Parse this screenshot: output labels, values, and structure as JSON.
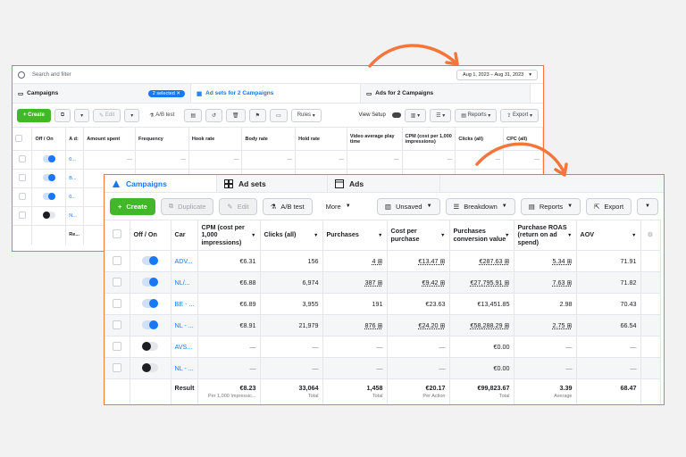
{
  "back": {
    "search_placeholder": "Search and filter",
    "date_range": "Aug 1, 2023 – Aug 31, 2023",
    "tabs": {
      "campaigns": "Campaigns",
      "selected": "2 selected",
      "adsets": "Ad sets for 2 Campaigns",
      "ads": "Ads for 2 Campaigns"
    },
    "toolbar": {
      "create": "Create",
      "edit": "Edit",
      "ab_test": "A/B test",
      "rules": "Rules",
      "view_setup": "View Setup",
      "reports": "Reports",
      "export": "Export"
    },
    "columns": [
      "Off / On",
      "A d:",
      "Amount spent",
      "Frequency",
      "Hook rate",
      "Body rate",
      "Hold rate",
      "Video average play time",
      "CPM (cost per 1,000 impressions)",
      "Clicks (all)",
      "CPC (all)"
    ],
    "rows": [
      {
        "name": "0...",
        "on": true
      },
      {
        "name": "B...",
        "on": true
      },
      {
        "name": "0...",
        "on": true
      },
      {
        "name": "N...",
        "on": false
      }
    ],
    "summary_label": "Re..."
  },
  "front": {
    "tabs": {
      "campaigns": "Campaigns",
      "adsets": "Ad sets",
      "ads": "Ads"
    },
    "toolbar": {
      "create": "Create",
      "duplicate": "Duplicate",
      "edit": "Edit",
      "ab_test": "A/B test",
      "more": "More",
      "unsaved": "Unsaved",
      "breakdown": "Breakdown",
      "reports": "Reports",
      "export": "Export"
    },
    "columns": {
      "offon": "Off / On",
      "campaign": "Car",
      "cpm": "CPM (cost per 1,000 impressions)",
      "clicks": "Clicks (all)",
      "purchases": "Purchases",
      "cpp": "Cost per purchase",
      "conv_value": "Purchases conversion value",
      "roas": "Purchase ROAS (return on ad spend)",
      "aov": "AOV"
    },
    "rows": [
      {
        "name": "ADV...",
        "on": true,
        "cpm": "€6.31",
        "clicks": "156",
        "purchases": "4 ⊞",
        "cpp": "€13.47 ⊞",
        "value": "€287.63 ⊞",
        "roas": "5.34 ⊞",
        "aov": "71.91"
      },
      {
        "name": "NL/...",
        "on": true,
        "cpm": "€6.88",
        "clicks": "6,974",
        "purchases": "387 ⊞",
        "cpp": "€9.42 ⊞",
        "value": "€27,795.91 ⊞",
        "roas": "7.63 ⊞",
        "aov": "71.82"
      },
      {
        "name": "BE - ...",
        "on": true,
        "cpm": "€6.89",
        "clicks": "3,955",
        "purchases": "191",
        "cpp": "€23.63",
        "value": "€13,451.85",
        "roas": "2.98",
        "aov": "70.43"
      },
      {
        "name": "NL - ...",
        "on": true,
        "cpm": "€8.91",
        "clicks": "21,979",
        "purchases": "876 ⊞",
        "cpp": "€24.20 ⊞",
        "value": "€58,288.29 ⊞",
        "roas": "2.75 ⊞",
        "aov": "66.54"
      },
      {
        "name": "AVS...",
        "on": false,
        "cpm": "—",
        "clicks": "—",
        "purchases": "—",
        "cpp": "—",
        "value": "€0.00",
        "roas": "—",
        "aov": "—"
      },
      {
        "name": "NL - ...",
        "on": false,
        "cpm": "—",
        "clicks": "—",
        "purchases": "—",
        "cpp": "—",
        "value": "€0.00",
        "roas": "—",
        "aov": "—"
      }
    ],
    "summary": {
      "label": "Result",
      "cpm": "€8.23",
      "cpm_sub": "Per 1,000 Impressic...",
      "clicks": "33,064",
      "clicks_sub": "Total",
      "purchases": "1,458",
      "purchases_sub": "Total",
      "cpp": "€20.17",
      "cpp_sub": "Per Action",
      "value": "€99,823.67",
      "value_sub": "Total",
      "roas": "3.39",
      "roas_sub": "Average",
      "aov": "68.47"
    }
  },
  "colors": {
    "accent": "#1877f2",
    "create_green": "#42b72a",
    "highlight_orange": "#f4763a"
  }
}
